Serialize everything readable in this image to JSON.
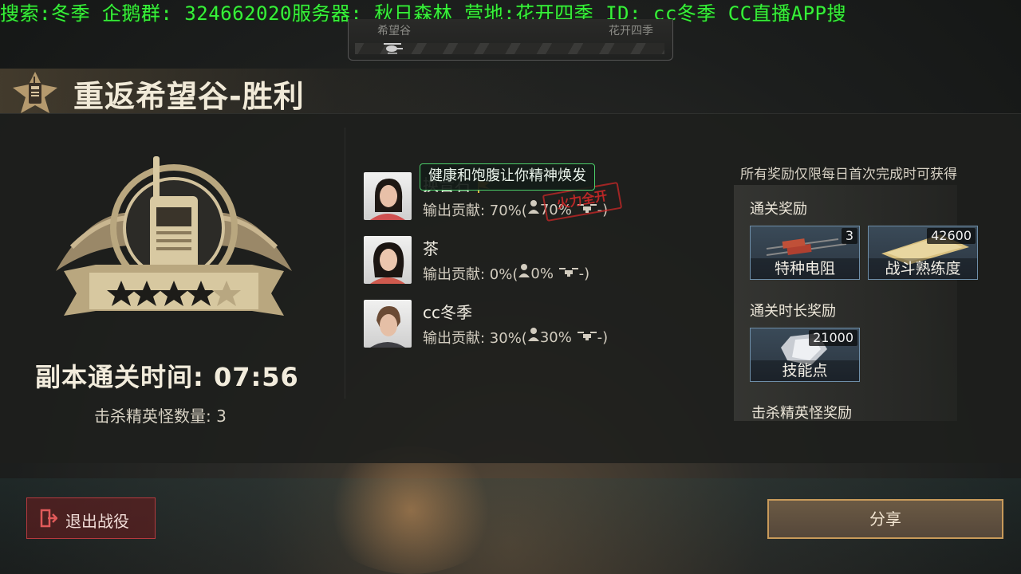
{
  "ticker": {
    "text": "搜索:冬季 企鹅群: 324662020服务器: 秋日森林 营地:花开四季 ID: cc冬季  CC直播APP搜"
  },
  "route": {
    "from": "希望谷",
    "to": "花开四季"
  },
  "header": {
    "title": "重返希望谷-胜利"
  },
  "result": {
    "stars_filled": 4,
    "stars_total": 5,
    "clear_time": "副本通关时间: 07:56",
    "elite_kills": "击杀精英怪数量: 3"
  },
  "tooltip": {
    "text": "健康和饱腹让你精神焕发"
  },
  "stamp": {
    "text": "火力全开"
  },
  "players": [
    {
      "name": "换音石",
      "stat_label": "输出贡献: 70%(",
      "share": "70%",
      "tail": "-)"
    },
    {
      "name": "茶",
      "stat_label": "输出贡献: 0%(",
      "share": "0%",
      "tail": "-)"
    },
    {
      "name": "cc冬季",
      "stat_label": "输出贡献: 30%(",
      "share": "30%",
      "tail": "-)"
    }
  ],
  "rewards": {
    "note": "所有奖励仅限每日首次完成时可获得",
    "clear_section": "通关奖励",
    "clear_items": [
      {
        "name": "特种电阻",
        "count": "3"
      },
      {
        "name": "战斗熟练度",
        "count": "42600"
      }
    ],
    "time_section": "通关时长奖励",
    "time_items": [
      {
        "name": "技能点",
        "count": "21000"
      }
    ],
    "elite_section": "击杀精英怪奖励"
  },
  "buttons": {
    "exit": "退出战役",
    "share": "分享"
  },
  "colors": {
    "ticker": "#38f03a",
    "tooltip_border": "#4cd06a",
    "exit_border": "#b6393e",
    "share_border": "#c89a5a"
  }
}
